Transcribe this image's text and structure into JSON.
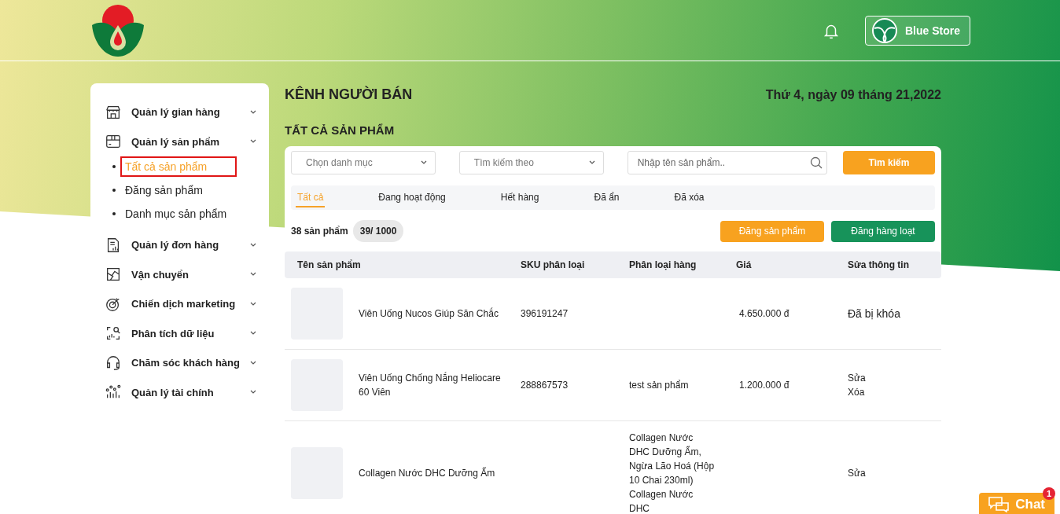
{
  "header": {
    "store_name": "Blue Store"
  },
  "sidebar": {
    "items": [
      {
        "label": "Quản lý gian hàng",
        "kind": "store"
      },
      {
        "label": "Quản lý sản phẩm",
        "kind": "box",
        "children": [
          {
            "label": "Tất cả sản phẩm",
            "selected": true
          },
          {
            "label": "Đăng sản phẩm",
            "selected": false
          },
          {
            "label": "Danh mục sản phẩm",
            "selected": false
          }
        ]
      },
      {
        "label": "Quản lý đơn hàng",
        "kind": "report"
      },
      {
        "label": "Vận chuyển",
        "kind": "map"
      },
      {
        "label": "Chiến dịch marketing",
        "kind": "target"
      },
      {
        "label": "Phân tích dữ liệu",
        "kind": "analytics"
      },
      {
        "label": "Chăm sóc khách hàng",
        "kind": "headset"
      },
      {
        "label": "Quản lý tài chính",
        "kind": "chart"
      }
    ]
  },
  "main": {
    "title": "KÊNH NGƯỜI BÁN",
    "date": "Thứ 4, ngày 09 tháng 21,2022",
    "section_title": "TẤT CẢ SẢN PHẨM",
    "filters": {
      "category_select": "Chọn danh mục",
      "search_by_select": "Tìm kiếm theo",
      "search_field": {
        "placeholder": "Nhập tên sản phẩm.."
      },
      "search_button": "Tìm kiếm"
    },
    "tabs": [
      {
        "label": "Tất cả",
        "selected": true
      },
      {
        "label": "Đang hoạt động",
        "selected": false
      },
      {
        "label": "Hết hàng",
        "selected": false
      },
      {
        "label": "Đã ẩn",
        "selected": false
      },
      {
        "label": "Đã xóa",
        "selected": false
      }
    ],
    "product_count": "38 sản phẩm",
    "quota": "39/ 1000",
    "buttons": {
      "post": "Đăng sản phẩm",
      "bulk_post": "Đăng hàng loạt"
    },
    "table": {
      "columns": [
        "Tên sản phẩm",
        "SKU phân loại",
        "Phân loại hàng",
        "Giá",
        "Sửa thông tin"
      ],
      "rows": [
        {
          "name": "Viên Uống Nucos Giúp Săn Chắc",
          "sku": "396191247",
          "variations": [],
          "price": "4.650.000 đ",
          "status": "Đã bị khóa",
          "actions": []
        },
        {
          "name": "Viên Uống Chống Nắng Heliocare 60 Viên",
          "sku": "288867573",
          "variations": [
            "test sản phẩm"
          ],
          "price": "1.200.000 đ",
          "actions": [
            "Sửa",
            "Xóa"
          ]
        },
        {
          "name": "Collagen Nước DHC Dưỡng Ẩm",
          "sku": "",
          "variations": [
            "Collagen Nước DHC Dưỡng Ẩm, Ngừa Lão Hoá (Hộp 10 Chai 230ml)",
            "Collagen Nước DHC"
          ],
          "price": "",
          "actions": [
            "Sửa"
          ]
        }
      ]
    }
  },
  "chat": {
    "label": "Chat",
    "badge": "1"
  }
}
